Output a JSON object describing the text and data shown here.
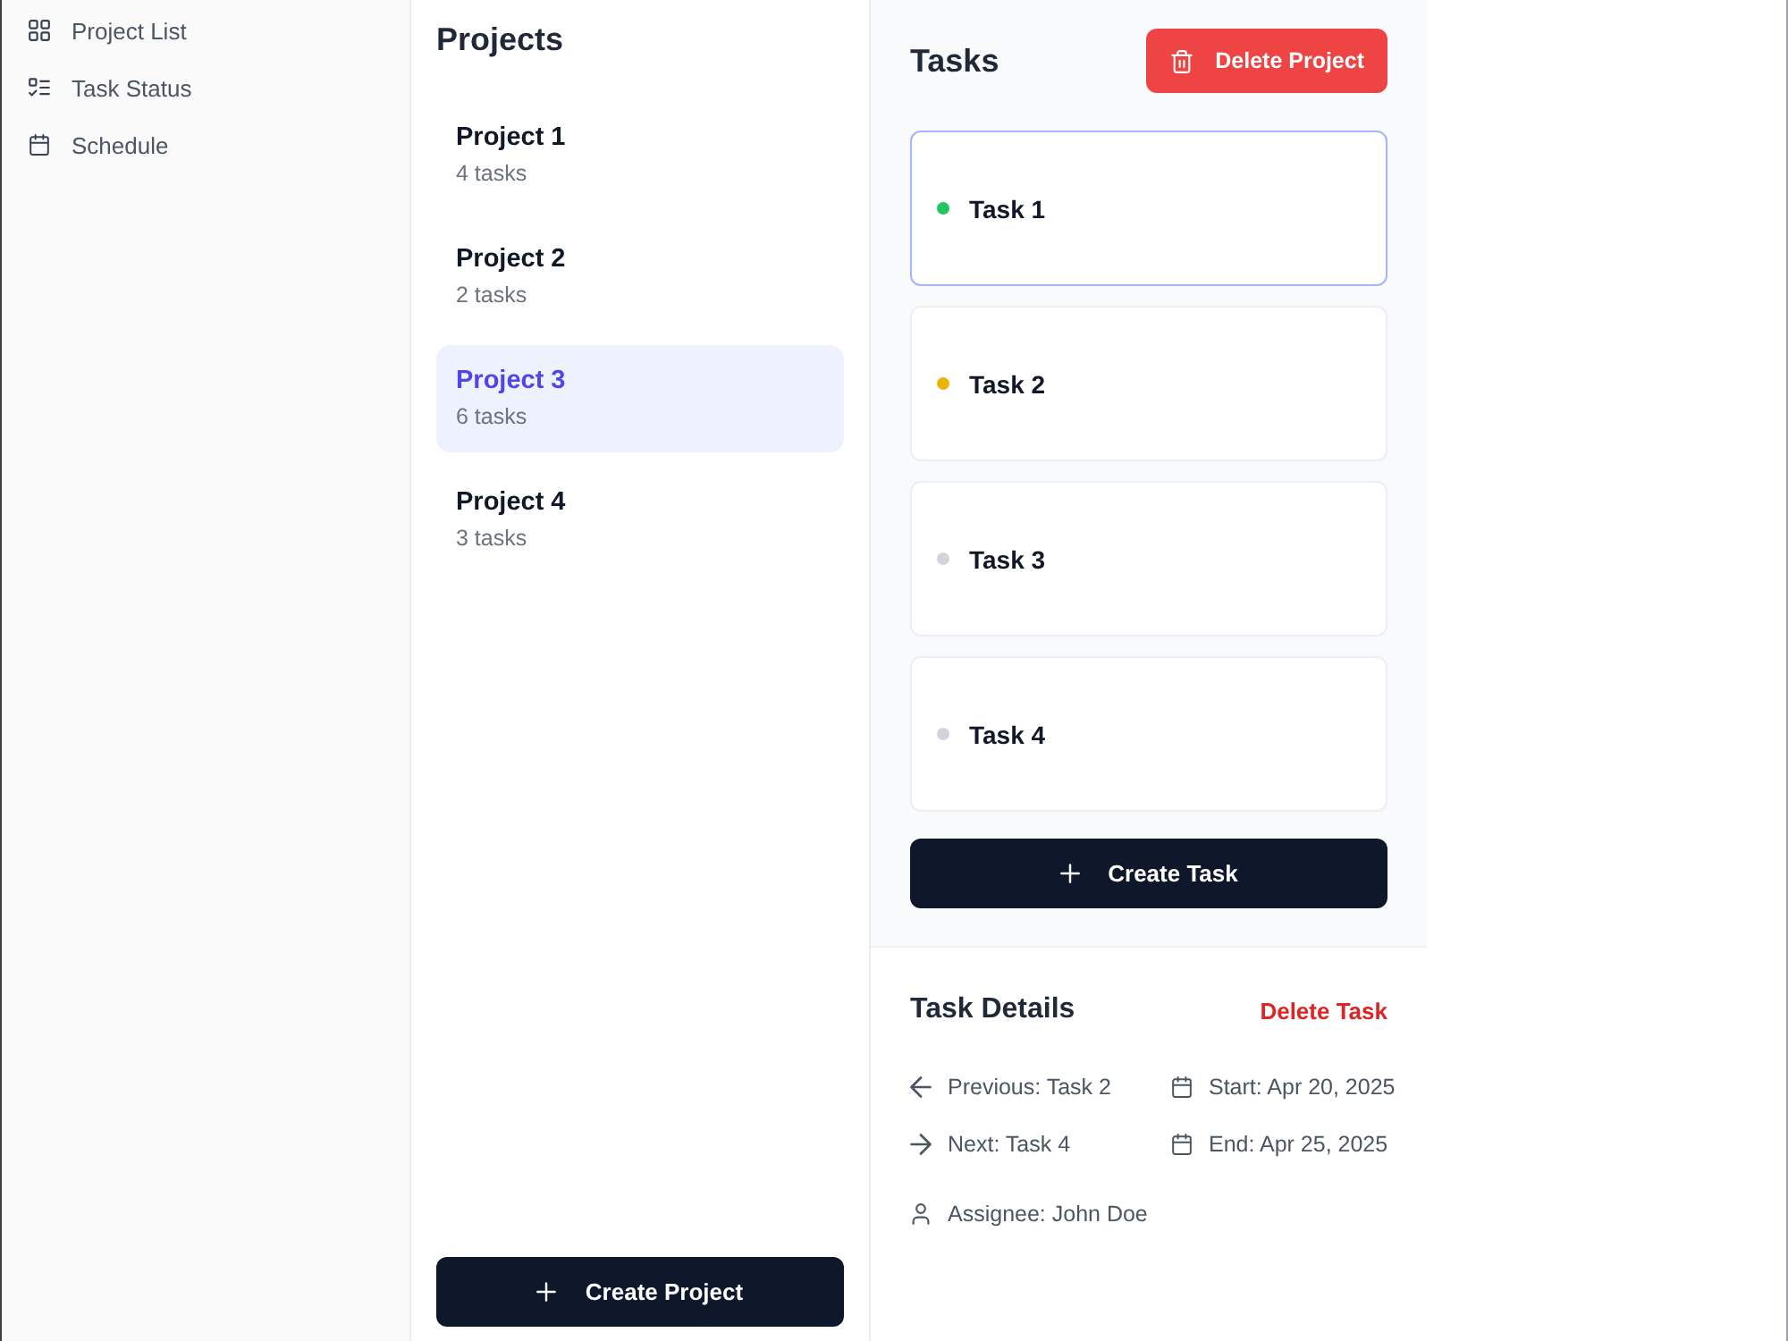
{
  "sidebar": {
    "items": [
      {
        "label": "Project List"
      },
      {
        "label": "Task Status"
      },
      {
        "label": "Schedule"
      }
    ]
  },
  "projects": {
    "title": "Projects",
    "items": [
      {
        "name": "Project 1",
        "count": "4 tasks",
        "selected": false
      },
      {
        "name": "Project 2",
        "count": "2 tasks",
        "selected": false
      },
      {
        "name": "Project 3",
        "count": "6 tasks",
        "selected": true
      },
      {
        "name": "Project 4",
        "count": "3 tasks",
        "selected": false
      }
    ],
    "create_button": "Create Project"
  },
  "tasks": {
    "title": "Tasks",
    "delete_button": "Delete Project",
    "items": [
      {
        "name": "Task 1",
        "color": "#22c55e",
        "selected": true
      },
      {
        "name": "Task 2",
        "color": "#eab308",
        "selected": false
      },
      {
        "name": "Task 3",
        "color": "#d1d5db",
        "selected": false
      },
      {
        "name": "Task 4",
        "color": "#d1d5db",
        "selected": false
      }
    ],
    "create_button": "Create Task"
  },
  "task_details": {
    "title": "Task Details",
    "delete_link": "Delete Task",
    "previous": "Previous: Task 2",
    "start": "Start: Apr 20, 2025",
    "next": "Next: Task 4",
    "end": "End: Apr 25, 2025",
    "assignee": "Assignee: John Doe"
  }
}
